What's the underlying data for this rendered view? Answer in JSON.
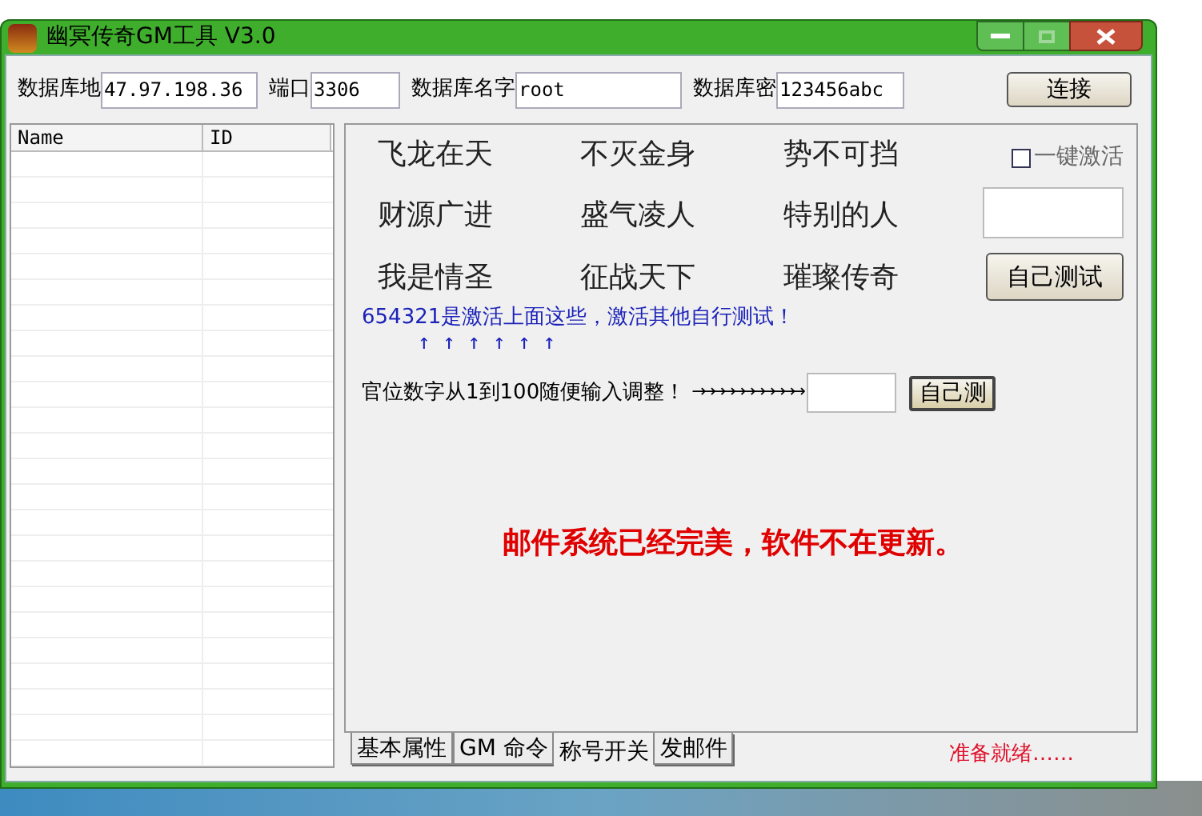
{
  "window": {
    "title": "幽冥传奇GM工具 V3.0"
  },
  "connection": {
    "fields": [
      {
        "label": "数据库地",
        "value": "47.97.198.36"
      },
      {
        "label": "端口",
        "value": "3306"
      },
      {
        "label": "数据库名字",
        "value": "root"
      },
      {
        "label": "数据库密",
        "value": "123456abc"
      }
    ],
    "button": "连接"
  },
  "table": {
    "columns": [
      "Name",
      "ID"
    ]
  },
  "titles": [
    "飞龙在天",
    "不灭金身",
    "势不可挡",
    "财源广进",
    "盛气凌人",
    "特别的人",
    "我是情圣",
    "征战天下",
    "璀璨传奇"
  ],
  "one_click": {
    "label": "一键激活",
    "checked": false
  },
  "test_button": "自己测试",
  "note": "654321是激活上面这些，激活其他自行测试！",
  "note_arrows": "↑ ↑ ↑ ↑ ↑ ↑",
  "rank_label": "官位数字从1到100随便输入调整！",
  "rank_arrows": "→→→→→→→→→→→",
  "rank_button": "自己测",
  "mail_notice": "邮件系统已经完美，软件不在更新。",
  "tabs": [
    {
      "label": "基本属性",
      "selected": false
    },
    {
      "label": "GM 命令",
      "selected": false
    },
    {
      "label": "称号开关",
      "selected": true
    },
    {
      "label": "发邮件",
      "selected": false
    }
  ],
  "status": "准备就绪……"
}
